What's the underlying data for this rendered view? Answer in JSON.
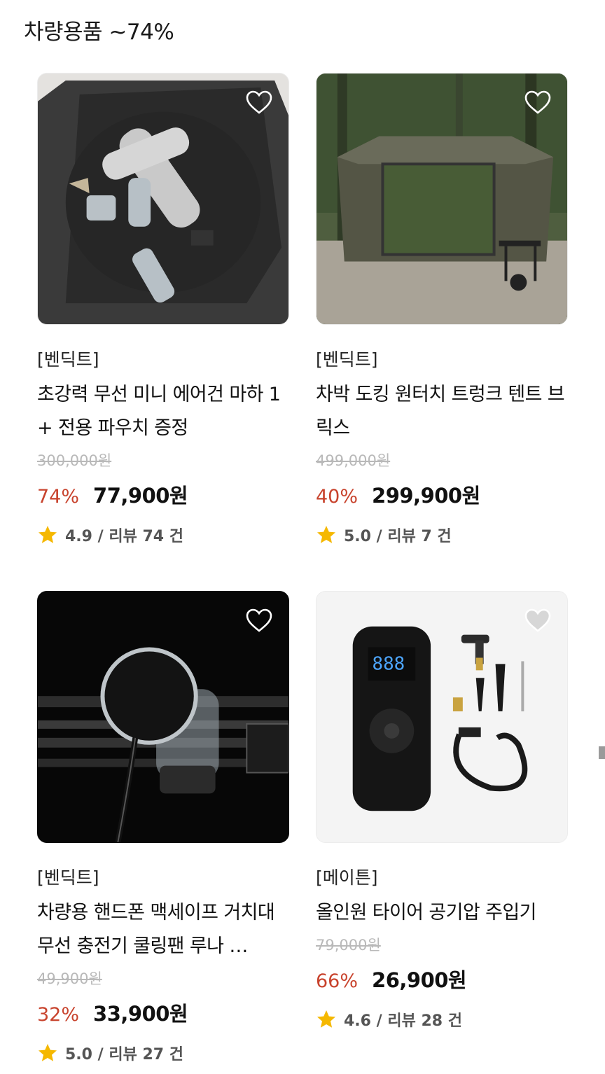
{
  "section": {
    "title": "차량용품 ~74%"
  },
  "products": [
    {
      "brand": "[벤딕트]",
      "name": "초강력 무선 미니 에어건 마하 1 + 전용 파우치 증정",
      "original_price": "300,000원",
      "discount": "74%",
      "price": "77,900원",
      "rating": "4.9 / 리뷰 74 건",
      "wishlisted": false
    },
    {
      "brand": "[벤딕트]",
      "name": "차박 도킹 원터치 트렁크 텐트 브릭스",
      "original_price": "499,000원",
      "discount": "40%",
      "price": "299,900원",
      "rating": "5.0 / 리뷰 7 건",
      "wishlisted": false
    },
    {
      "brand": "[벤딕트]",
      "name": "차량용 핸드폰 맥세이프 거치대 무선 충전기 쿨링팬 루나 …",
      "original_price": "49,900원",
      "discount": "32%",
      "price": "33,900원",
      "rating": "5.0 / 리뷰 27 건",
      "wishlisted": false
    },
    {
      "brand": "[메이튼]",
      "name": "올인원 타이어 공기압 주입기",
      "original_price": "79,000원",
      "discount": "66%",
      "price": "26,900원",
      "rating": "4.6 / 리뷰 28 건",
      "wishlisted": false
    }
  ],
  "icons": {
    "wishlist": "heart-icon",
    "rating": "star-icon"
  },
  "colors": {
    "discount": "#c8432d",
    "star": "#f5b800",
    "original_price": "#b9b9b9"
  },
  "images": {
    "pump_display": "888"
  }
}
